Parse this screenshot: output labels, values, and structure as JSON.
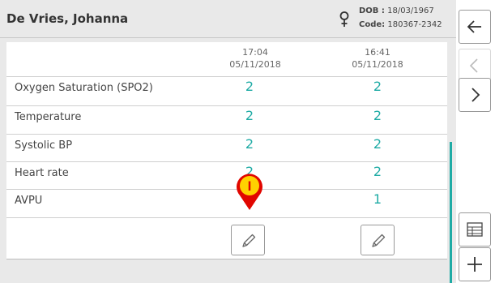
{
  "header": {
    "patient_name": "De Vries, Johanna",
    "dob_label": "DOB :",
    "dob_value": "18/03/1967",
    "code_label": "Code:",
    "code_value": "180367-2342",
    "gender_icon": "female-icon"
  },
  "columns": [
    {
      "time": "17:04",
      "date": "05/11/2018"
    },
    {
      "time": "16:41",
      "date": "05/11/2018"
    }
  ],
  "rows": [
    {
      "label": "Oxygen Saturation (SPO2)",
      "values": [
        "2",
        "2"
      ]
    },
    {
      "label": "Temperature",
      "values": [
        "2",
        "2"
      ]
    },
    {
      "label": "Systolic BP",
      "values": [
        "2",
        "2"
      ]
    },
    {
      "label": "Heart rate",
      "values": [
        "2",
        "2"
      ]
    },
    {
      "label": "AVPU",
      "values": [
        "",
        "1"
      ]
    }
  ],
  "marker": {
    "label": "I",
    "color": "#e10600",
    "fill": "#ffd200"
  },
  "colors": {
    "accent": "#1faba5"
  },
  "nav": [
    {
      "name": "back-button",
      "icon": "arrow-left-icon",
      "enabled": true
    },
    {
      "name": "previous-button",
      "icon": "chevron-left-icon",
      "enabled": false
    },
    {
      "name": "next-button",
      "icon": "chevron-right-icon",
      "enabled": true
    },
    {
      "name": "table-view-button",
      "icon": "table-icon",
      "enabled": true
    },
    {
      "name": "add-button",
      "icon": "plus-icon",
      "enabled": true
    }
  ]
}
